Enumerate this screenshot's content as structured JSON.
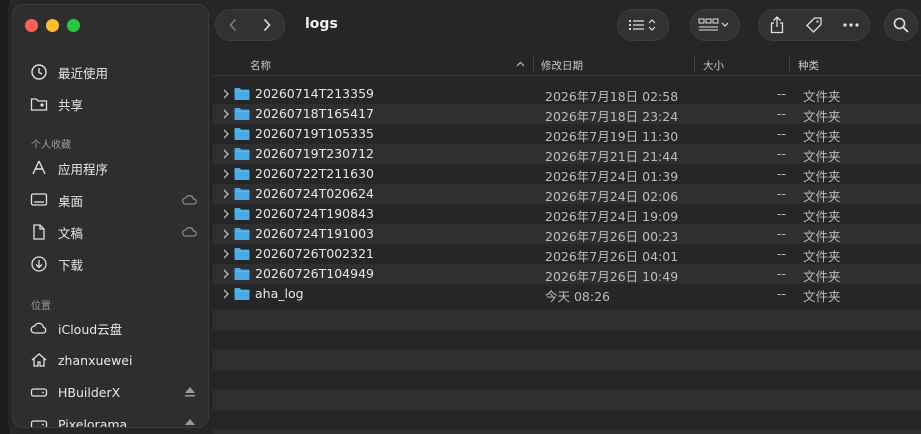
{
  "window": {
    "folder_title": "logs"
  },
  "sidebar": {
    "recents_label": "最近使用",
    "shared_label": "共享",
    "favorites_header": "个人收藏",
    "favorites": [
      {
        "label": "应用程序",
        "icon": "applications-icon"
      },
      {
        "label": "桌面",
        "icon": "desktop-icon",
        "cloud": true
      },
      {
        "label": "文稿",
        "icon": "documents-icon",
        "cloud": true
      },
      {
        "label": "下载",
        "icon": "downloads-icon"
      }
    ],
    "locations_header": "位置",
    "locations": [
      {
        "label": "iCloud云盘",
        "icon": "icloud-icon"
      },
      {
        "label": "zhanxuewei",
        "icon": "home-icon"
      },
      {
        "label": "HBuilderX",
        "icon": "disk-icon",
        "eject": true
      },
      {
        "label": "Pixelorama",
        "icon": "disk-icon",
        "eject": true
      }
    ]
  },
  "columns": {
    "name": "名称",
    "date": "修改日期",
    "size": "大小",
    "kind": "种类"
  },
  "rows": [
    {
      "name": "20260714T213359",
      "date": "2026年7月18日 02:58",
      "size": "--",
      "kind": "文件夹"
    },
    {
      "name": "20260718T165417",
      "date": "2026年7月18日 23:24",
      "size": "--",
      "kind": "文件夹"
    },
    {
      "name": "20260719T105335",
      "date": "2026年7月19日 11:30",
      "size": "--",
      "kind": "文件夹"
    },
    {
      "name": "20260719T230712",
      "date": "2026年7月21日 21:44",
      "size": "--",
      "kind": "文件夹"
    },
    {
      "name": "20260722T211630",
      "date": "2026年7月24日 01:39",
      "size": "--",
      "kind": "文件夹"
    },
    {
      "name": "20260724T020624",
      "date": "2026年7月24日 02:06",
      "size": "--",
      "kind": "文件夹"
    },
    {
      "name": "20260724T190843",
      "date": "2026年7月24日 19:09",
      "size": "--",
      "kind": "文件夹"
    },
    {
      "name": "20260724T191003",
      "date": "2026年7月26日 00:23",
      "size": "--",
      "kind": "文件夹"
    },
    {
      "name": "20260726T002321",
      "date": "2026年7月26日 04:01",
      "size": "--",
      "kind": "文件夹"
    },
    {
      "name": "20260726T104949",
      "date": "2026年7月26日 10:49",
      "size": "--",
      "kind": "文件夹"
    },
    {
      "name": "aha_log",
      "date": "今天 08:26",
      "size": "--",
      "kind": "文件夹"
    }
  ],
  "colors": {
    "folder": "#4ba9e6",
    "accent_red": "#ff5f57",
    "accent_yellow": "#febc2e",
    "accent_green": "#28c840"
  }
}
